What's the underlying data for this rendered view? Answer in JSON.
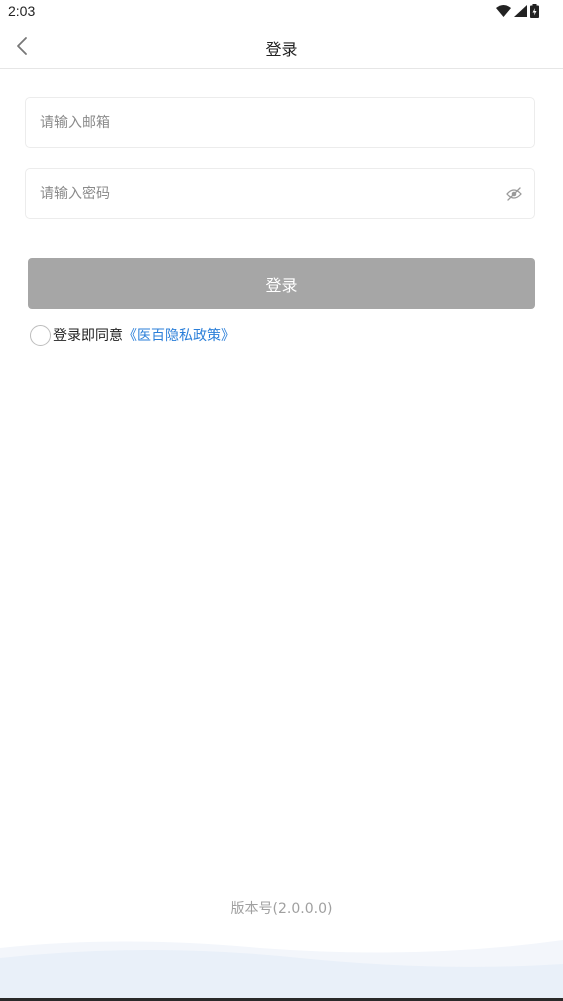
{
  "status_bar": {
    "time": "2:03",
    "icons": [
      "wifi-icon",
      "signal-icon",
      "battery-icon"
    ]
  },
  "nav": {
    "title": "登录",
    "back_icon": "chevron-left-icon"
  },
  "form": {
    "email_placeholder": "请输入邮箱",
    "email_value": "",
    "password_placeholder": "请输入密码",
    "password_value": "",
    "eye_icon": "eye-off-icon",
    "login_button_label": "登录",
    "agree_prefix": "登录即同意",
    "policy_link": "《医百隐私政策》",
    "agree_checked": false
  },
  "footer": {
    "version": "版本号(2.0.0.0)"
  },
  "colors": {
    "button_disabled": "#a6a6a6",
    "link": "#2b7fd9",
    "footer_wave": "#e9f0f9"
  }
}
